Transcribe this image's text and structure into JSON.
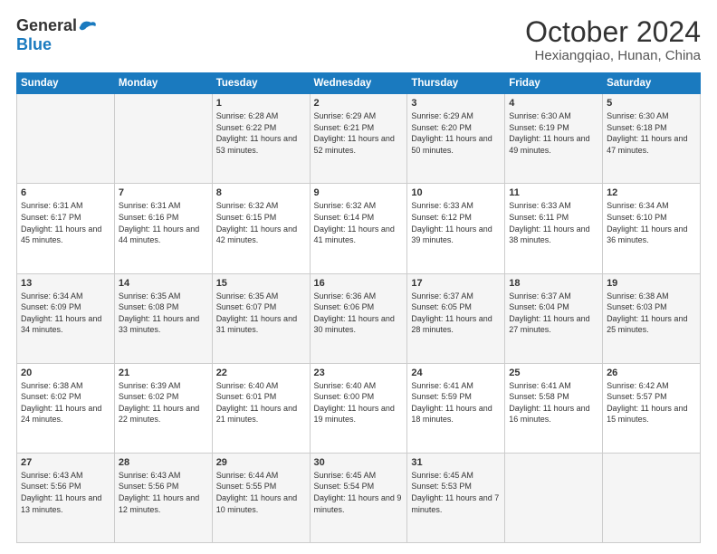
{
  "logo": {
    "general": "General",
    "blue": "Blue"
  },
  "title": {
    "month": "October 2024",
    "location": "Hexiangqiao, Hunan, China"
  },
  "headers": [
    "Sunday",
    "Monday",
    "Tuesday",
    "Wednesday",
    "Thursday",
    "Friday",
    "Saturday"
  ],
  "weeks": [
    [
      {
        "day": "",
        "text": ""
      },
      {
        "day": "",
        "text": ""
      },
      {
        "day": "1",
        "text": "Sunrise: 6:28 AM\nSunset: 6:22 PM\nDaylight: 11 hours and 53 minutes."
      },
      {
        "day": "2",
        "text": "Sunrise: 6:29 AM\nSunset: 6:21 PM\nDaylight: 11 hours and 52 minutes."
      },
      {
        "day": "3",
        "text": "Sunrise: 6:29 AM\nSunset: 6:20 PM\nDaylight: 11 hours and 50 minutes."
      },
      {
        "day": "4",
        "text": "Sunrise: 6:30 AM\nSunset: 6:19 PM\nDaylight: 11 hours and 49 minutes."
      },
      {
        "day": "5",
        "text": "Sunrise: 6:30 AM\nSunset: 6:18 PM\nDaylight: 11 hours and 47 minutes."
      }
    ],
    [
      {
        "day": "6",
        "text": "Sunrise: 6:31 AM\nSunset: 6:17 PM\nDaylight: 11 hours and 45 minutes."
      },
      {
        "day": "7",
        "text": "Sunrise: 6:31 AM\nSunset: 6:16 PM\nDaylight: 11 hours and 44 minutes."
      },
      {
        "day": "8",
        "text": "Sunrise: 6:32 AM\nSunset: 6:15 PM\nDaylight: 11 hours and 42 minutes."
      },
      {
        "day": "9",
        "text": "Sunrise: 6:32 AM\nSunset: 6:14 PM\nDaylight: 11 hours and 41 minutes."
      },
      {
        "day": "10",
        "text": "Sunrise: 6:33 AM\nSunset: 6:12 PM\nDaylight: 11 hours and 39 minutes."
      },
      {
        "day": "11",
        "text": "Sunrise: 6:33 AM\nSunset: 6:11 PM\nDaylight: 11 hours and 38 minutes."
      },
      {
        "day": "12",
        "text": "Sunrise: 6:34 AM\nSunset: 6:10 PM\nDaylight: 11 hours and 36 minutes."
      }
    ],
    [
      {
        "day": "13",
        "text": "Sunrise: 6:34 AM\nSunset: 6:09 PM\nDaylight: 11 hours and 34 minutes."
      },
      {
        "day": "14",
        "text": "Sunrise: 6:35 AM\nSunset: 6:08 PM\nDaylight: 11 hours and 33 minutes."
      },
      {
        "day": "15",
        "text": "Sunrise: 6:35 AM\nSunset: 6:07 PM\nDaylight: 11 hours and 31 minutes."
      },
      {
        "day": "16",
        "text": "Sunrise: 6:36 AM\nSunset: 6:06 PM\nDaylight: 11 hours and 30 minutes."
      },
      {
        "day": "17",
        "text": "Sunrise: 6:37 AM\nSunset: 6:05 PM\nDaylight: 11 hours and 28 minutes."
      },
      {
        "day": "18",
        "text": "Sunrise: 6:37 AM\nSunset: 6:04 PM\nDaylight: 11 hours and 27 minutes."
      },
      {
        "day": "19",
        "text": "Sunrise: 6:38 AM\nSunset: 6:03 PM\nDaylight: 11 hours and 25 minutes."
      }
    ],
    [
      {
        "day": "20",
        "text": "Sunrise: 6:38 AM\nSunset: 6:02 PM\nDaylight: 11 hours and 24 minutes."
      },
      {
        "day": "21",
        "text": "Sunrise: 6:39 AM\nSunset: 6:02 PM\nDaylight: 11 hours and 22 minutes."
      },
      {
        "day": "22",
        "text": "Sunrise: 6:40 AM\nSunset: 6:01 PM\nDaylight: 11 hours and 21 minutes."
      },
      {
        "day": "23",
        "text": "Sunrise: 6:40 AM\nSunset: 6:00 PM\nDaylight: 11 hours and 19 minutes."
      },
      {
        "day": "24",
        "text": "Sunrise: 6:41 AM\nSunset: 5:59 PM\nDaylight: 11 hours and 18 minutes."
      },
      {
        "day": "25",
        "text": "Sunrise: 6:41 AM\nSunset: 5:58 PM\nDaylight: 11 hours and 16 minutes."
      },
      {
        "day": "26",
        "text": "Sunrise: 6:42 AM\nSunset: 5:57 PM\nDaylight: 11 hours and 15 minutes."
      }
    ],
    [
      {
        "day": "27",
        "text": "Sunrise: 6:43 AM\nSunset: 5:56 PM\nDaylight: 11 hours and 13 minutes."
      },
      {
        "day": "28",
        "text": "Sunrise: 6:43 AM\nSunset: 5:56 PM\nDaylight: 11 hours and 12 minutes."
      },
      {
        "day": "29",
        "text": "Sunrise: 6:44 AM\nSunset: 5:55 PM\nDaylight: 11 hours and 10 minutes."
      },
      {
        "day": "30",
        "text": "Sunrise: 6:45 AM\nSunset: 5:54 PM\nDaylight: 11 hours and 9 minutes."
      },
      {
        "day": "31",
        "text": "Sunrise: 6:45 AM\nSunset: 5:53 PM\nDaylight: 11 hours and 7 minutes."
      },
      {
        "day": "",
        "text": ""
      },
      {
        "day": "",
        "text": ""
      }
    ]
  ]
}
